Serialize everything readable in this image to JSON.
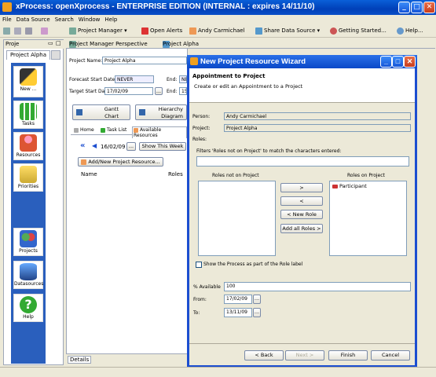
{
  "window": {
    "title": "xProcess: openXprocess - ENTERPRISE EDITION  (INTERNAL : expires 14/11/10)"
  },
  "menu": [
    "File",
    "Data Source",
    "Search",
    "Window",
    "Help"
  ],
  "toolbar": {
    "project_manager": "Project Manager",
    "open_alerts": "Open Alerts",
    "user": "Andy Carmichael",
    "share_data_source": "Share Data Source",
    "getting_started": "Getting Started...",
    "help": "Help..."
  },
  "left_panel": {
    "view_tab": "Proje",
    "project_tab": "Project Alpha",
    "nav": [
      {
        "label": "New ...",
        "icon": "wand-icon"
      },
      {
        "label": "Tasks",
        "icon": "tasks-icon"
      },
      {
        "label": "Resources",
        "icon": "person-icon"
      },
      {
        "label": "Priorities",
        "icon": "clock-icon"
      },
      {
        "label": "Projects",
        "icon": "people-icon"
      },
      {
        "label": "Datasources",
        "icon": "database-icon"
      },
      {
        "label": "Help",
        "icon": "help-icon"
      }
    ]
  },
  "editor_tabs": {
    "perspective": "Project Manager Perspective",
    "project": "Project Alpha"
  },
  "editor": {
    "project_name_label": "Project Name:",
    "project_name": "Project Alpha",
    "forecast_start_label": "Forecast Start Date:",
    "forecast_start": "NEVER",
    "end_label": "End:",
    "forecast_end": "NEVER",
    "target_start_label": "Target Start Date:",
    "target_start": "17/02/09",
    "target_end": "15",
    "gantt": "Gantt\nChart",
    "hierarchy": "Hierarchy\nDiagram",
    "sub_tabs": [
      "Home",
      "Task List",
      "Available Resources"
    ],
    "date": "16/02/09",
    "show_week": "Show This Week",
    "add_resource": "Add/New Project Resource...",
    "col_name": "Name",
    "col_roles": "Roles",
    "details_tab": "Details"
  },
  "dialog": {
    "title": "New Project Resource Wizard",
    "heading": "Appointment to Project",
    "subheading": "Create or edit an Appointment to a Project",
    "person_label": "Person:",
    "person": "Andy Carmichael",
    "project_label": "Project:",
    "project": "Project Alpha",
    "roles_label": "Roles:",
    "filter_text": "Filters 'Roles not on Project' to match the characters entered:",
    "roles_not_on_project": "Roles not on Project",
    "roles_on_project": "Roles on Project",
    "roles_on_project_items": [
      "Participant"
    ],
    "btn_add": ">",
    "btn_remove": "<",
    "btn_new_role": "< New Role",
    "btn_add_all": "Add all Roles >",
    "show_process_label": "Show the Process as part of the Role label",
    "available_label": "% Available",
    "available": "100",
    "from_label": "From:",
    "from": "17/02/09",
    "to_label": "To:",
    "to": "13/11/09",
    "back": "< Back",
    "next": "Next >",
    "finish": "Finish",
    "cancel": "Cancel"
  }
}
